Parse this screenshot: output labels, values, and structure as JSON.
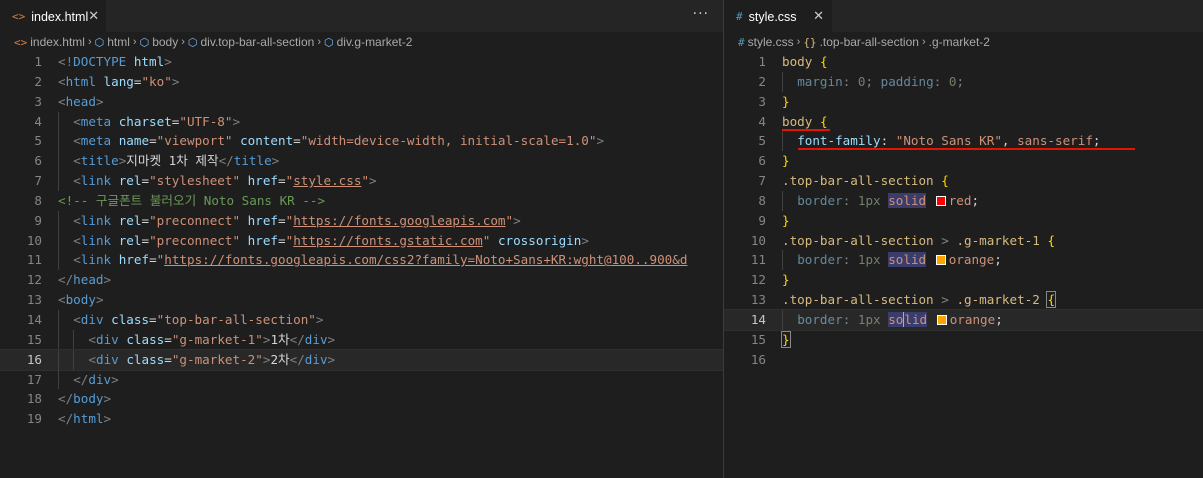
{
  "left": {
    "tab": {
      "icon": "html-file-icon",
      "icon_glyph": "<>",
      "label": "index.html",
      "close": "✕",
      "more": "···"
    },
    "breadcrumb": [
      {
        "icon": "html-file-icon",
        "glyph": "<>",
        "label": "index.html"
      },
      {
        "icon": "element-cube-icon",
        "glyph": "⬡",
        "label": "html"
      },
      {
        "icon": "element-cube-icon",
        "glyph": "⬡",
        "label": "body"
      },
      {
        "icon": "element-cube-icon",
        "glyph": "⬡",
        "label": "div.top-bar-all-section"
      },
      {
        "icon": "element-cube-icon",
        "glyph": "⬡",
        "label": "div.g-market-2"
      }
    ],
    "lines": [
      {
        "n": "1",
        "tokens": [
          [
            "t-br",
            "<!"
          ],
          [
            "t-tag",
            "DOCTYPE"
          ],
          [
            "t-txt",
            " "
          ],
          [
            "t-attr",
            "html"
          ],
          [
            "t-br",
            ">"
          ]
        ]
      },
      {
        "n": "2",
        "tokens": [
          [
            "t-br",
            "<"
          ],
          [
            "t-tag",
            "html"
          ],
          [
            "t-txt",
            " "
          ],
          [
            "t-attr",
            "lang"
          ],
          [
            "t-txt",
            "="
          ],
          [
            "t-str",
            "\"ko\""
          ],
          [
            "t-br",
            ">"
          ]
        ]
      },
      {
        "n": "3",
        "tokens": [
          [
            "t-br",
            "<"
          ],
          [
            "t-tag",
            "head"
          ],
          [
            "t-br",
            ">"
          ]
        ]
      },
      {
        "n": "4",
        "indent": 1,
        "tokens": [
          [
            "t-br",
            "<"
          ],
          [
            "t-tag",
            "meta"
          ],
          [
            "t-txt",
            " "
          ],
          [
            "t-attr",
            "charset"
          ],
          [
            "t-txt",
            "="
          ],
          [
            "t-str",
            "\"UTF-8\""
          ],
          [
            "t-br",
            ">"
          ]
        ]
      },
      {
        "n": "5",
        "indent": 1,
        "tokens": [
          [
            "t-br",
            "<"
          ],
          [
            "t-tag",
            "meta"
          ],
          [
            "t-txt",
            " "
          ],
          [
            "t-attr",
            "name"
          ],
          [
            "t-txt",
            "="
          ],
          [
            "t-str",
            "\"viewport\""
          ],
          [
            "t-txt",
            " "
          ],
          [
            "t-attr",
            "content"
          ],
          [
            "t-txt",
            "="
          ],
          [
            "t-str",
            "\"width=device-width, initial-scale=1.0\""
          ],
          [
            "t-br",
            ">"
          ]
        ]
      },
      {
        "n": "6",
        "indent": 1,
        "tokens": [
          [
            "t-br",
            "<"
          ],
          [
            "t-tag",
            "title"
          ],
          [
            "t-br",
            ">"
          ],
          [
            "t-txt",
            "지마켓 1차 제작"
          ],
          [
            "t-br",
            "</"
          ],
          [
            "t-tag",
            "title"
          ],
          [
            "t-br",
            ">"
          ]
        ]
      },
      {
        "n": "7",
        "indent": 1,
        "tokens": [
          [
            "t-br",
            "<"
          ],
          [
            "t-tag",
            "link"
          ],
          [
            "t-txt",
            " "
          ],
          [
            "t-attr",
            "rel"
          ],
          [
            "t-txt",
            "="
          ],
          [
            "t-str",
            "\"stylesheet\""
          ],
          [
            "t-txt",
            " "
          ],
          [
            "t-attr",
            "href"
          ],
          [
            "t-txt",
            "="
          ],
          [
            "t-str",
            "\""
          ],
          [
            "t-str t-link",
            "style.css"
          ],
          [
            "t-str",
            "\""
          ],
          [
            "t-br",
            ">"
          ]
        ]
      },
      {
        "n": "8",
        "tokens": [
          [
            "t-com",
            "<!-- 구글폰트 불러오기 Noto Sans KR -->"
          ]
        ]
      },
      {
        "n": "9",
        "indent": 1,
        "tokens": [
          [
            "t-br",
            "<"
          ],
          [
            "t-tag",
            "link"
          ],
          [
            "t-txt",
            " "
          ],
          [
            "t-attr",
            "rel"
          ],
          [
            "t-txt",
            "="
          ],
          [
            "t-str",
            "\"preconnect\""
          ],
          [
            "t-txt",
            " "
          ],
          [
            "t-attr",
            "href"
          ],
          [
            "t-txt",
            "="
          ],
          [
            "t-str",
            "\""
          ],
          [
            "t-str t-link",
            "https://fonts.googleapis.com"
          ],
          [
            "t-str",
            "\""
          ],
          [
            "t-br",
            ">"
          ]
        ]
      },
      {
        "n": "10",
        "indent": 1,
        "tokens": [
          [
            "t-br",
            "<"
          ],
          [
            "t-tag",
            "link"
          ],
          [
            "t-txt",
            " "
          ],
          [
            "t-attr",
            "rel"
          ],
          [
            "t-txt",
            "="
          ],
          [
            "t-str",
            "\"preconnect\""
          ],
          [
            "t-txt",
            " "
          ],
          [
            "t-attr",
            "href"
          ],
          [
            "t-txt",
            "="
          ],
          [
            "t-str",
            "\""
          ],
          [
            "t-str t-link",
            "https://fonts.gstatic.com"
          ],
          [
            "t-str",
            "\""
          ],
          [
            "t-txt",
            " "
          ],
          [
            "t-attr",
            "crossorigin"
          ],
          [
            "t-br",
            ">"
          ]
        ]
      },
      {
        "n": "11",
        "indent": 1,
        "tokens": [
          [
            "t-br",
            "<"
          ],
          [
            "t-tag",
            "link"
          ],
          [
            "t-txt",
            " "
          ],
          [
            "t-attr",
            "href"
          ],
          [
            "t-txt",
            "="
          ],
          [
            "t-str",
            "\""
          ],
          [
            "t-str t-link",
            "https://fonts.googleapis.com/css2?family=Noto+Sans+KR:wght@100..900&d"
          ]
        ]
      },
      {
        "n": "12",
        "tokens": [
          [
            "t-br",
            "</"
          ],
          [
            "t-tag",
            "head"
          ],
          [
            "t-br",
            ">"
          ]
        ]
      },
      {
        "n": "13",
        "tokens": [
          [
            "t-br",
            "<"
          ],
          [
            "t-tag",
            "body"
          ],
          [
            "t-br",
            ">"
          ]
        ]
      },
      {
        "n": "14",
        "indent": 1,
        "tokens": [
          [
            "t-br",
            "<"
          ],
          [
            "t-tag",
            "div"
          ],
          [
            "t-txt",
            " "
          ],
          [
            "t-attr",
            "class"
          ],
          [
            "t-txt",
            "="
          ],
          [
            "t-str",
            "\"top-bar-all-section\""
          ],
          [
            "t-br",
            ">"
          ]
        ]
      },
      {
        "n": "15",
        "indent": 2,
        "tokens": [
          [
            "t-br",
            "<"
          ],
          [
            "t-tag",
            "div"
          ],
          [
            "t-txt",
            " "
          ],
          [
            "t-attr",
            "class"
          ],
          [
            "t-txt",
            "="
          ],
          [
            "t-str",
            "\"g-market-1\""
          ],
          [
            "t-br",
            ">"
          ],
          [
            "t-txt",
            "1차"
          ],
          [
            "t-br",
            "</"
          ],
          [
            "t-tag",
            "div"
          ],
          [
            "t-br",
            ">"
          ]
        ]
      },
      {
        "n": "16",
        "indent": 2,
        "current": true,
        "tokens": [
          [
            "t-br",
            "<"
          ],
          [
            "t-tag",
            "div"
          ],
          [
            "t-txt",
            " "
          ],
          [
            "t-attr",
            "class"
          ],
          [
            "t-txt",
            "="
          ],
          [
            "t-str",
            "\"g-market-2\""
          ],
          [
            "t-br",
            ">"
          ],
          [
            "t-txt",
            "2차"
          ],
          [
            "t-br",
            "</"
          ],
          [
            "t-tag",
            "div"
          ],
          [
            "t-br",
            ">"
          ]
        ]
      },
      {
        "n": "17",
        "indent": 1,
        "tokens": [
          [
            "t-br",
            "</"
          ],
          [
            "t-tag",
            "div"
          ],
          [
            "t-br",
            ">"
          ]
        ]
      },
      {
        "n": "18",
        "tokens": [
          [
            "t-br",
            "</"
          ],
          [
            "t-tag",
            "body"
          ],
          [
            "t-br",
            ">"
          ]
        ]
      },
      {
        "n": "19",
        "tokens": [
          [
            "t-br",
            "</"
          ],
          [
            "t-tag",
            "html"
          ],
          [
            "t-br",
            ">"
          ]
        ]
      }
    ]
  },
  "right": {
    "tab": {
      "icon": "css-file-icon",
      "icon_glyph": "#",
      "label": "style.css",
      "close": "✕"
    },
    "breadcrumb": [
      {
        "icon": "css-file-icon",
        "glyph": "#",
        "label": "style.css"
      },
      {
        "icon": "selector-icon",
        "glyph": "{}",
        "label": ".top-bar-all-section"
      },
      {
        "icon": "",
        "glyph": "",
        "label": ".g-market-2"
      }
    ],
    "lines": [
      {
        "n": "1",
        "tokens": [
          [
            "t-sel",
            "body"
          ],
          [
            "t-txt",
            " "
          ],
          [
            "t-brace",
            "{"
          ]
        ]
      },
      {
        "n": "2",
        "indent": 1,
        "tokens": [
          [
            "t-prop dim",
            "margin"
          ],
          [
            "t-op dim",
            ": "
          ],
          [
            "t-num dim",
            "0"
          ],
          [
            "t-op dim",
            "; "
          ],
          [
            "t-prop dim",
            "padding"
          ],
          [
            "t-op dim",
            ": "
          ],
          [
            "t-num dim",
            "0"
          ],
          [
            "t-op dim",
            ";"
          ]
        ]
      },
      {
        "n": "3",
        "tokens": [
          [
            "t-brace",
            "}"
          ]
        ]
      },
      {
        "n": "4",
        "tokens": [
          [
            "t-sel",
            "body"
          ],
          [
            "t-txt",
            " "
          ],
          [
            "t-brace",
            "{"
          ]
        ],
        "underline": [
          0,
          48
        ]
      },
      {
        "n": "5",
        "indent": 1,
        "tokens": [
          [
            "t-prop",
            "font-family"
          ],
          [
            "t-op",
            ": "
          ],
          [
            "t-str",
            "\"Noto Sans KR\""
          ],
          [
            "t-op",
            ", "
          ],
          [
            "t-kw",
            "sans-serif"
          ],
          [
            "t-op",
            ";"
          ]
        ],
        "underline": [
          16,
          337
        ]
      },
      {
        "n": "6",
        "tokens": [
          [
            "t-brace",
            "}"
          ]
        ]
      },
      {
        "n": "7",
        "tokens": [
          [
            "t-sel",
            ".top-bar-all-section"
          ],
          [
            "t-txt",
            " "
          ],
          [
            "t-brace",
            "{"
          ]
        ]
      },
      {
        "n": "8",
        "indent": 1,
        "tokens": [
          [
            "t-prop dim",
            "border"
          ],
          [
            "t-op dim",
            ": "
          ],
          [
            "t-num dim",
            "1px"
          ],
          [
            "t-txt",
            " "
          ],
          [
            "hl-word t-kw",
            "solid"
          ],
          [
            "t-txt",
            " "
          ],
          [
            "swatch",
            "#ff0000"
          ],
          [
            "t-kw",
            "red"
          ],
          [
            "t-op",
            ";"
          ]
        ]
      },
      {
        "n": "9",
        "tokens": [
          [
            "t-brace",
            "}"
          ]
        ]
      },
      {
        "n": "10",
        "tokens": [
          [
            "t-sel",
            ".top-bar-all-section"
          ],
          [
            "t-txt",
            " "
          ],
          [
            "t-op dim",
            ">"
          ],
          [
            "t-txt",
            " "
          ],
          [
            "t-sel",
            ".g-market-1"
          ],
          [
            "t-txt",
            " "
          ],
          [
            "t-brace",
            "{"
          ]
        ]
      },
      {
        "n": "11",
        "indent": 1,
        "tokens": [
          [
            "t-prop dim",
            "border"
          ],
          [
            "t-op dim",
            ": "
          ],
          [
            "t-num dim",
            "1px"
          ],
          [
            "t-txt",
            " "
          ],
          [
            "hl-word t-kw",
            "solid"
          ],
          [
            "t-txt",
            " "
          ],
          [
            "swatch",
            "#ffa500"
          ],
          [
            "t-kw",
            "orange"
          ],
          [
            "t-op",
            ";"
          ]
        ]
      },
      {
        "n": "12",
        "tokens": [
          [
            "t-brace",
            "}"
          ]
        ]
      },
      {
        "n": "13",
        "tokens": [
          [
            "t-sel",
            ".top-bar-all-section"
          ],
          [
            "t-txt",
            " "
          ],
          [
            "t-op dim",
            ">"
          ],
          [
            "t-txt",
            " "
          ],
          [
            "t-sel",
            ".g-market-2"
          ],
          [
            "t-txt",
            " "
          ],
          [
            "t-brace bracket-box",
            "{"
          ]
        ]
      },
      {
        "n": "14",
        "indent": 1,
        "current": true,
        "tokens": [
          [
            "t-prop dim",
            "border"
          ],
          [
            "t-op dim",
            ": "
          ],
          [
            "t-num dim",
            "1px"
          ],
          [
            "t-txt",
            " "
          ],
          [
            "hl-word t-kw",
            "so"
          ],
          [
            "cursor",
            ""
          ],
          [
            "hl-word t-kw",
            "lid"
          ],
          [
            "t-txt",
            " "
          ],
          [
            "swatch",
            "#ffa500"
          ],
          [
            "t-kw",
            "orange"
          ],
          [
            "t-op",
            ";"
          ]
        ]
      },
      {
        "n": "15",
        "tokens": [
          [
            "t-brace bracket-box",
            "}"
          ]
        ]
      },
      {
        "n": "16",
        "tokens": []
      }
    ]
  }
}
